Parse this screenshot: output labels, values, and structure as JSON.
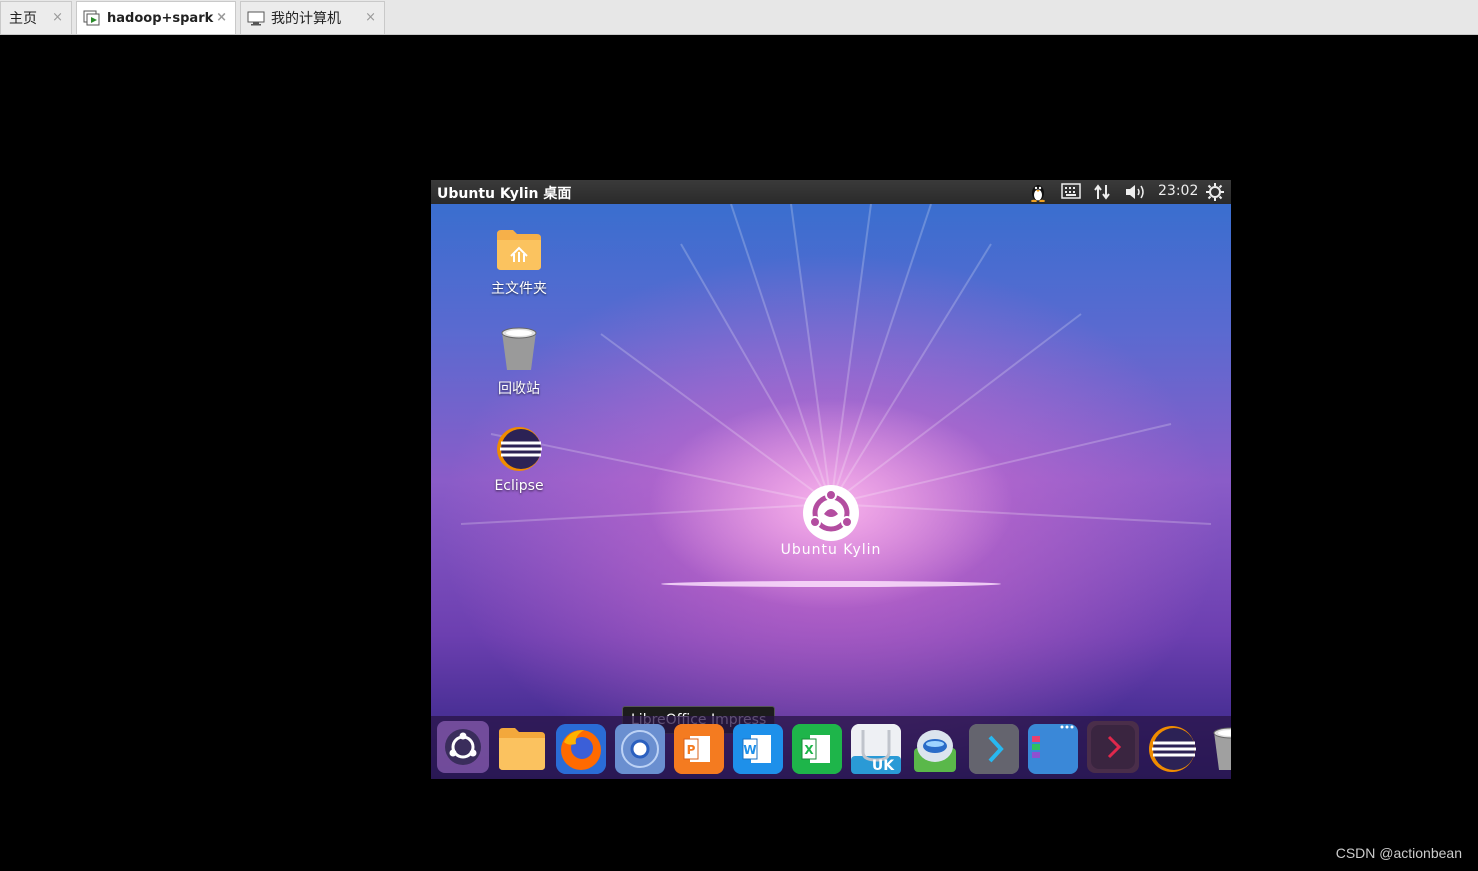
{
  "tabs": [
    {
      "label": "主页",
      "active": false
    },
    {
      "label": "hadoop+spark",
      "active": true
    },
    {
      "label": "我的计算机",
      "active": false
    }
  ],
  "close_glyph": "×",
  "vm": {
    "topbar_title": "Ubuntu Kylin 桌面",
    "clock": "23:02",
    "desktop_icons": [
      {
        "label": "主文件夹",
        "icon": "home-folder-icon"
      },
      {
        "label": "回收站",
        "icon": "trash-icon"
      },
      {
        "label": "Eclipse",
        "icon": "eclipse-icon"
      }
    ],
    "logo_text": "Ubuntu Kylin",
    "tooltip": "LibreOffice Impress",
    "dock_items": [
      "ubuntu-kylin-launcher-icon",
      "files-icon",
      "firefox-icon",
      "browser-icon",
      "libreoffice-impress-icon",
      "libreoffice-writer-icon",
      "libreoffice-calc-icon",
      "software-center-icon",
      "youker-assistant-icon",
      "next-arrow-icon",
      "workspaces-icon",
      "terminal-icon",
      "eclipse-icon",
      "trash-icon"
    ],
    "dock_labels": {
      "writer": "W",
      "calc": "X",
      "impress": "P",
      "software": "UK"
    }
  },
  "watermark": "CSDN @actionbean"
}
